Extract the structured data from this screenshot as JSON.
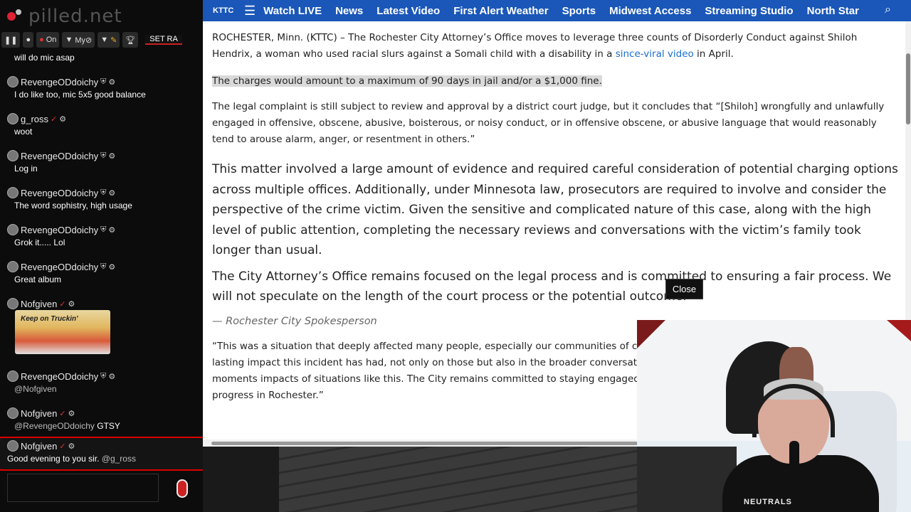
{
  "chat": {
    "logo_text": "pilled.net",
    "toolbar": {
      "on_label": "On",
      "my_label": "My⊘",
      "set_label": "SET RA"
    },
    "messages": [
      {
        "user": "",
        "text": "will do mic asap"
      },
      {
        "user": "RevengeODdoichy",
        "text": "I do like too, mic 5x5 good balance"
      },
      {
        "user": "g_ross",
        "text": "woot"
      },
      {
        "user": "RevengeODdoichy",
        "text": "Log in"
      },
      {
        "user": "RevengeODdoichy",
        "text": "The word sophistry, high usage"
      },
      {
        "user": "RevengeODdoichy",
        "text": "Grok it..... Lol"
      },
      {
        "user": "RevengeODdoichy",
        "text": "Great album"
      },
      {
        "user": "Nofgiven",
        "image_text": "Keep on Truckin'"
      },
      {
        "user": "RevengeODdoichy",
        "mention": "@Nofgiven"
      },
      {
        "user": "Nofgiven",
        "mention": "@RevengeODdoichy",
        "text": "GTSY"
      },
      {
        "user": "Nofgiven",
        "text": "Good evening to you sir.",
        "mention": "@g_ross"
      }
    ]
  },
  "browser": {
    "nav": {
      "brand": "KTTC",
      "items": [
        "Watch LIVE",
        "News",
        "Latest Video",
        "First Alert Weather",
        "Sports",
        "Midwest Access",
        "Streaming Studio",
        "North Star"
      ]
    },
    "article": {
      "p1_text": "ROCHESTER, Minn. (KTTC) – The Rochester City Attorney’s Office moves to leverage three counts of Disorderly Conduct against Shiloh Hendrix, a woman who used racial slurs against a Somali child with a disability in a ",
      "p1_link": "since-viral video",
      "p1_end": " in April.",
      "highlight": "The charges would amount to a maximum of 90 days in jail and/or a $1,000 fine.",
      "p2": "The legal complaint is still subject to review and approval by a district court judge, but it concludes that “[Shiloh] wrongfully and unlawfully engaged in offensive, obscene, abusive, boisterous, or noisy conduct, or in offensive obscene, or abusive language that would reasonably tend to arouse alarm, anger, or resentment in others.”",
      "quote1": "This matter involved a large amount of evidence and required careful consideration of potential charging options across multiple offices. Additionally, under Minnesota law, prosecutors are required to involve and consider the perspective of the crime victim. Given the sensitive and complicated nature of this case, along with the high level of public attention, completing the necessary reviews and conversations with the victim’s family took longer than usual.",
      "quote2": "The City Attorney’s Office remains focused on the legal process and is committed to ensuring a fair process. We will not speculate on the length of the court process or the potential outcome.",
      "cite": "— Rochester City Spokesperson",
      "p3": "“This was a situation that deeply affected many people, especially our communities of color, and Mayor Kim Norton. “We acknowledge the lasting impact this incident has had, not only on those but also in the broader conversations happening at the state and national level. These moments impacts of situations like this. The City remains committed to staying engaged and proceeding that support accountability and progress in Rochester.”"
    },
    "close_label": "Close"
  },
  "webcam": {
    "shirt_text": "NEUTRALS"
  }
}
